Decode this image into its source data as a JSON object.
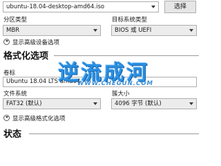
{
  "boot": {
    "image_value": "ubuntu-18.04-desktop-amd64.iso",
    "select_button": "选择"
  },
  "partition": {
    "scheme_label": "分区类型",
    "scheme_value": "MBR",
    "target_label": "目标系统类型",
    "target_value": "BIOS 或 UEFI"
  },
  "advanced_drive_toggle": "显示高级设备选项",
  "format": {
    "section_title": "格式化选项",
    "volume_label": "卷标",
    "volume_value": "Ubuntu 18.04 LTS amd64",
    "fs_label": "文件系统",
    "fs_value": "FAT32 (默认)",
    "cluster_label": "簇大小",
    "cluster_value": "4096 字节 (默认)",
    "advanced_format_toggle": "显示高级格式化选项"
  },
  "status": {
    "section_title": "状态"
  },
  "watermark": {
    "text": "逆流成河",
    "url": "WWW.CHEGUN.COM"
  },
  "colors": {
    "watermark_blue": "#2b8fe0",
    "rule_gray": "#9a9a9a"
  }
}
